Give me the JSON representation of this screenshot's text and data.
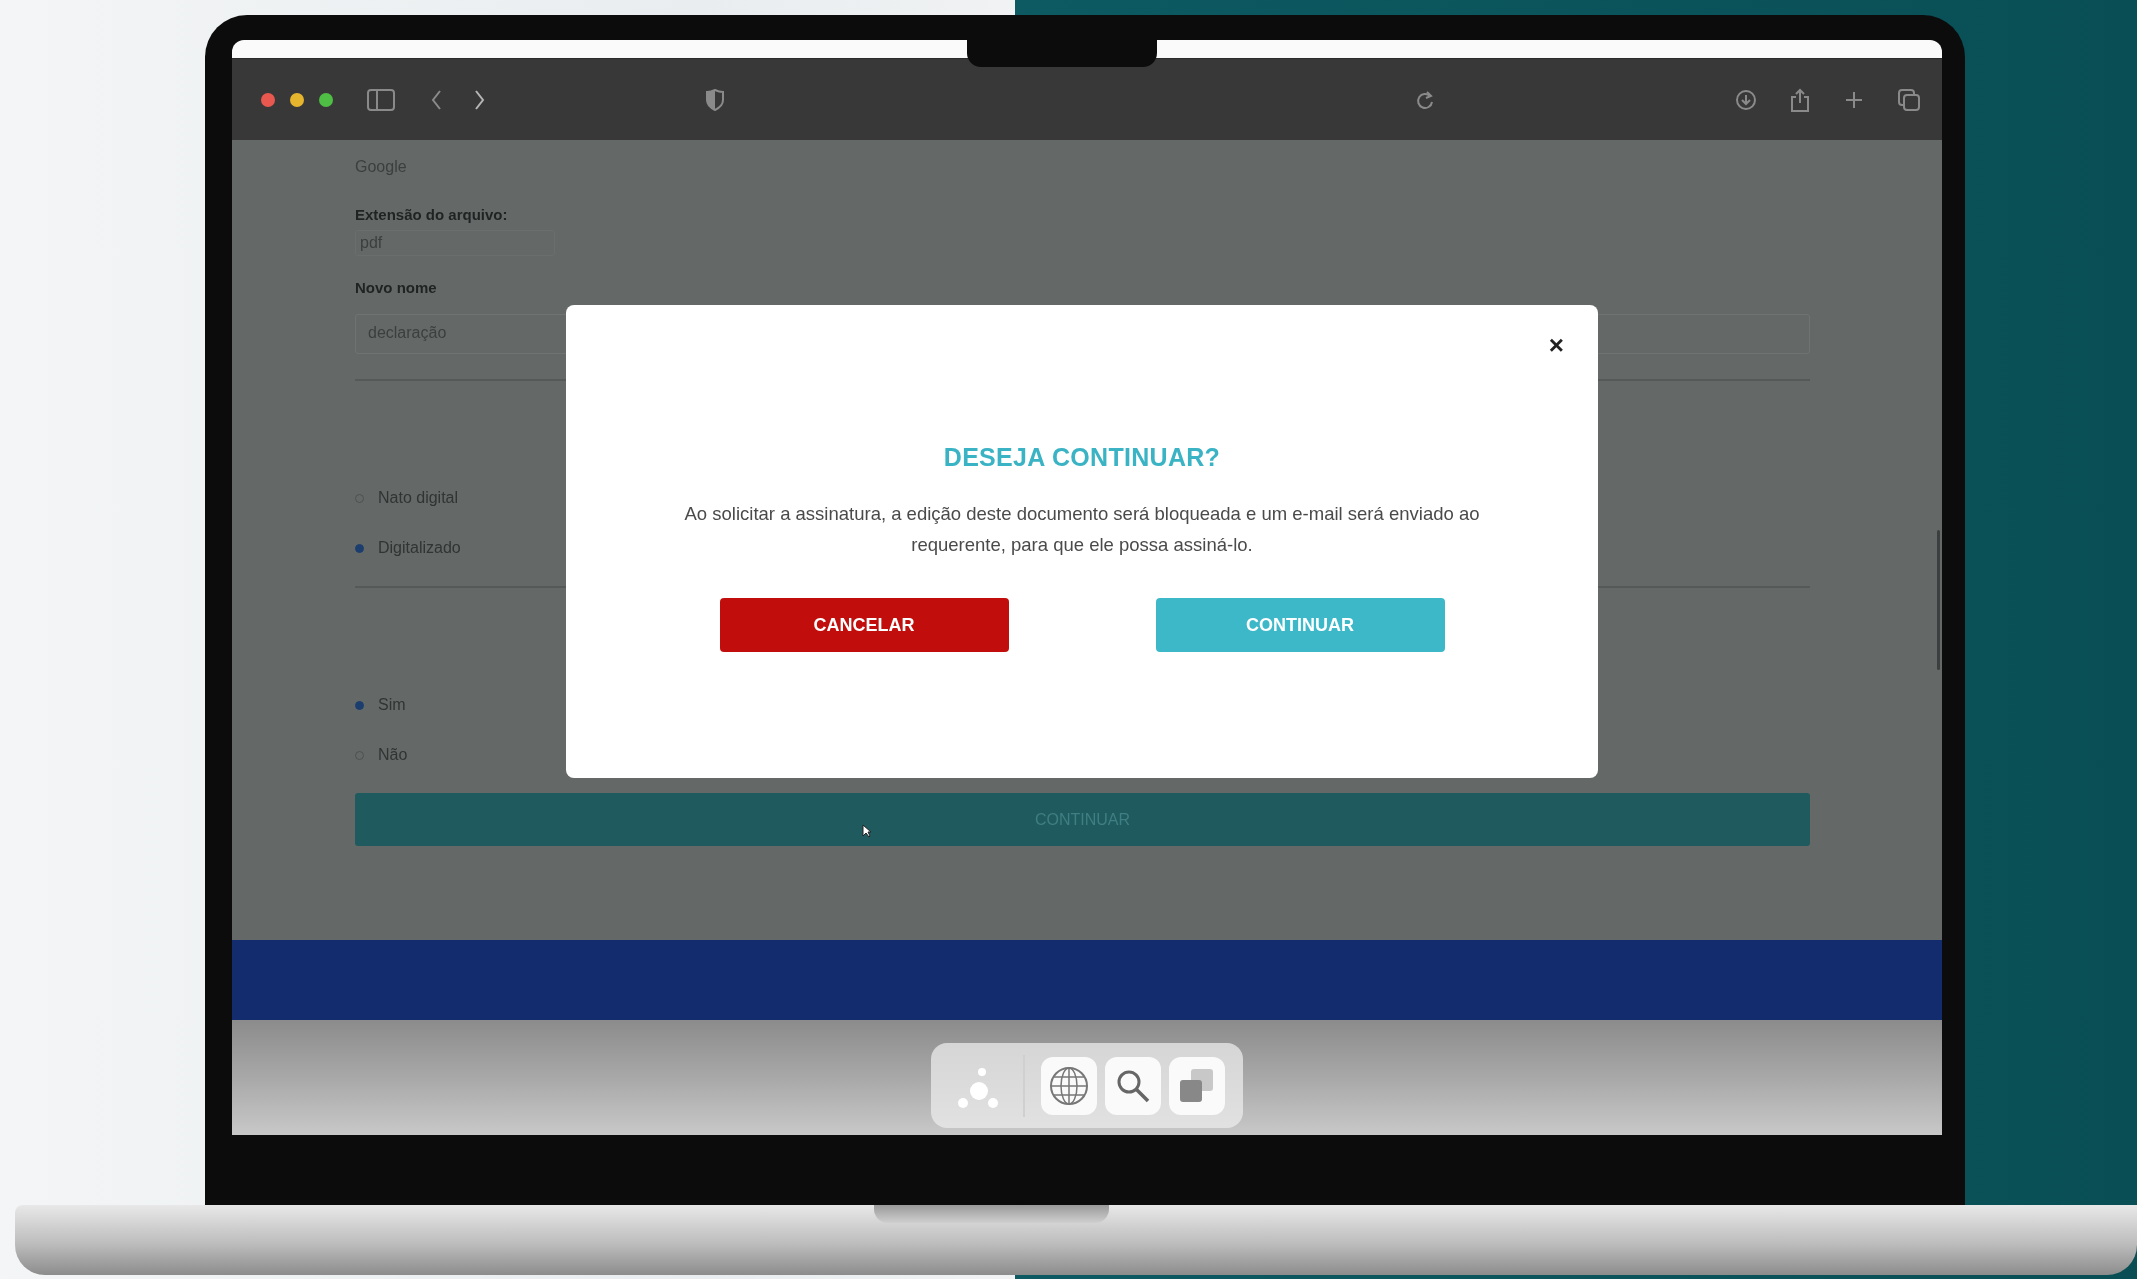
{
  "form": {
    "current_name": "Google",
    "extension": {
      "label": "Extensão do arquivo:",
      "value": "pdf"
    },
    "new_name": {
      "label": "Novo nome",
      "value": "declaração"
    },
    "type_options": [
      {
        "label": "Nato digital",
        "selected": false
      },
      {
        "label": "Digitalizado",
        "selected": true
      }
    ],
    "yes_no_options": [
      {
        "label": "Sim",
        "selected": true
      },
      {
        "label": "Não",
        "selected": false
      }
    ],
    "submit": "CONTINUAR"
  },
  "modal": {
    "close": "×",
    "title": "DESEJA CONTINUAR?",
    "message": "Ao solicitar a assinatura, a edição deste documento será bloqueada e um e-mail será enviado ao requerente, para que ele possa assiná-lo.",
    "buttons": [
      {
        "kind": "cancel",
        "label": "CANCELAR"
      },
      {
        "kind": "confirm",
        "label": "CONTINUAR"
      }
    ]
  }
}
